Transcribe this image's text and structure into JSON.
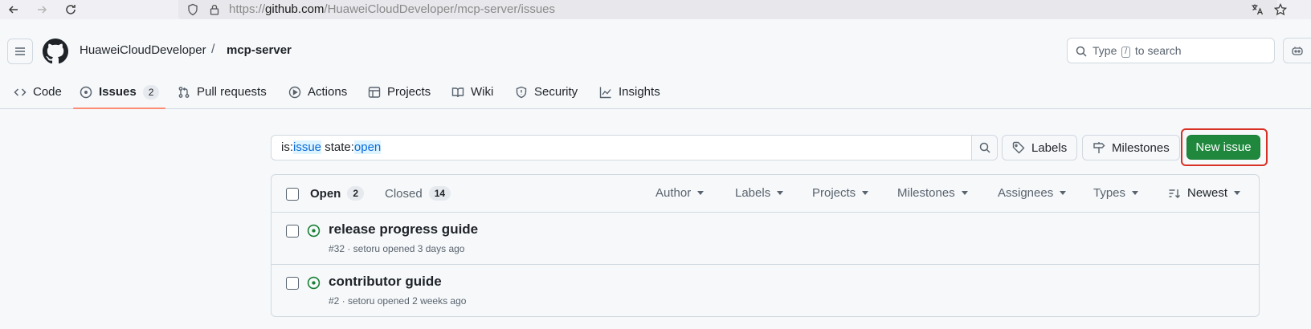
{
  "browser": {
    "url_prefix": "https://",
    "url_domain": "github.com",
    "url_path": "/HuaweiCloudDeveloper/mcp-server/issues"
  },
  "header": {
    "owner": "HuaweiCloudDeveloper",
    "separator": "/",
    "repo": "mcp-server",
    "search_prefix": "Type",
    "search_key": "/",
    "search_suffix": "to search"
  },
  "tabs": [
    {
      "label": "Code",
      "icon": "code-icon"
    },
    {
      "label": "Issues",
      "icon": "issue-opened-icon",
      "count": "2",
      "active": true
    },
    {
      "label": "Pull requests",
      "icon": "git-pull-request-icon"
    },
    {
      "label": "Actions",
      "icon": "play-icon"
    },
    {
      "label": "Projects",
      "icon": "table-icon"
    },
    {
      "label": "Wiki",
      "icon": "book-icon"
    },
    {
      "label": "Security",
      "icon": "shield-icon"
    },
    {
      "label": "Insights",
      "icon": "graph-icon"
    }
  ],
  "filter": {
    "part1": "is:",
    "part2": "issue",
    "part3": " state:",
    "part4": "open"
  },
  "buttons": {
    "labels": "Labels",
    "milestones": "Milestones",
    "new_issue": "New issue"
  },
  "list_header": {
    "open_label": "Open",
    "open_count": "2",
    "closed_label": "Closed",
    "closed_count": "14",
    "filters": [
      "Author",
      "Labels",
      "Projects",
      "Milestones",
      "Assignees",
      "Types"
    ],
    "sort": "Newest"
  },
  "issues": [
    {
      "title": "release progress guide",
      "meta": "#32 · setoru opened 3 days ago"
    },
    {
      "title": "contributor guide",
      "meta": "#2 · setoru opened 2 weeks ago"
    }
  ],
  "colors": {
    "accent_green": "#1f883d",
    "open_icon": "#1a7f37",
    "active_tab_underline": "#fd8c73",
    "highlight_outline": "#d93025"
  }
}
